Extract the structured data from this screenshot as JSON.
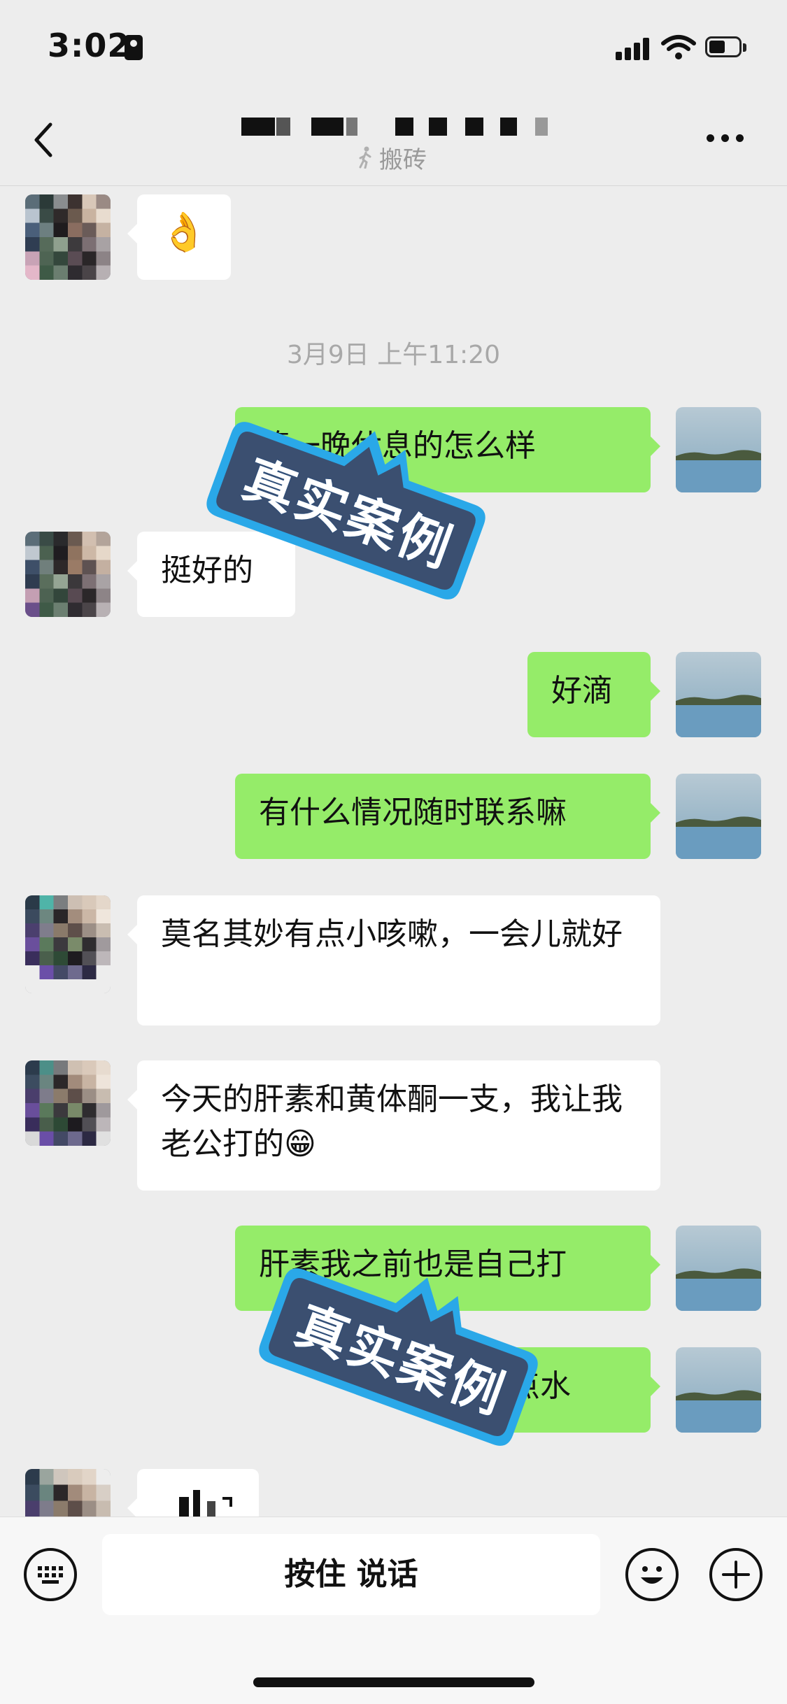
{
  "status_bar": {
    "time": "3:02"
  },
  "header": {
    "subtitle": "搬砖"
  },
  "timestamp": "3月9日 上午11:20",
  "messages": [
    {
      "side": "left",
      "text": "👌"
    },
    {
      "side": "right",
      "text": "第一晚休息的怎么样",
      "visible_text_note": "partially covered by watermark"
    },
    {
      "side": "left",
      "text": "挺好的"
    },
    {
      "side": "right",
      "text": "好滴"
    },
    {
      "side": "right",
      "text": "有什么情况随时联系嘛"
    },
    {
      "side": "left",
      "text": "莫名其妙有点小咳嗽，一会儿就好"
    },
    {
      "side": "left",
      "text": "今天的肝素和黄体酮一支，我让我老公打的😁"
    },
    {
      "side": "right",
      "text": "肝素我之前也是自己打"
    },
    {
      "side": "right",
      "text": "喝点水"
    }
  ],
  "watermark": {
    "text": "真实案例"
  },
  "input_bar": {
    "talk_label": "按住 说话"
  },
  "colors": {
    "background": "#ededed",
    "sent_bubble": "#95ec69",
    "received_bubble": "#ffffff",
    "watermark_blue": "#2aa8e8",
    "watermark_dark": "#3b4f70"
  }
}
